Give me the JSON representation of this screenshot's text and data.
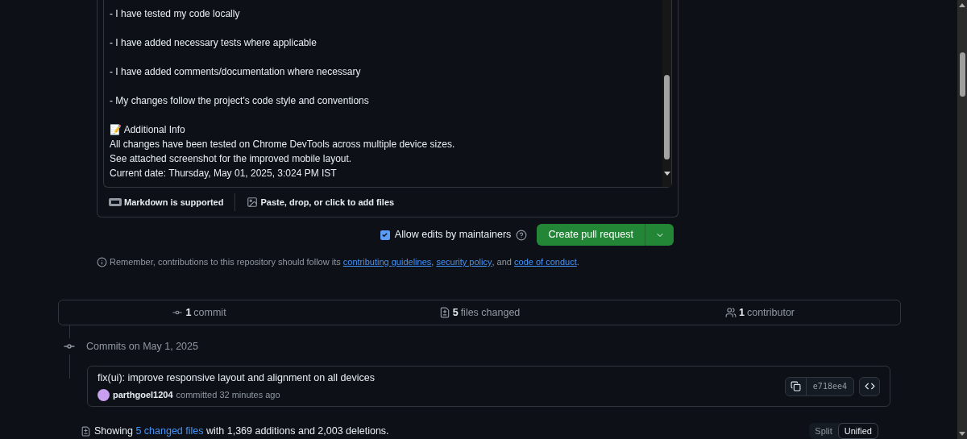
{
  "description": {
    "paragraphs": [
      [
        "-  I have tested my code locally"
      ],
      [
        "- I have added necessary tests where applicable"
      ],
      [
        "- I have added comments/documentation where necessary"
      ],
      [
        "- My changes follow the project's code style and conventions"
      ],
      [
        "📝 Additional Info",
        "All changes have been tested on Chrome DevTools across multiple device sizes.",
        "See attached screenshot for the improved mobile layout.",
        "Current date: Thursday, May 01, 2025, 3:024 PM IST"
      ]
    ],
    "footer": [
      "Markdown is supported",
      "Paste, drop, or click to add files"
    ]
  },
  "allow_edits": {
    "label": "Allow edits by maintainers",
    "checked": true
  },
  "create_button": "Create pull request",
  "notice": {
    "text": "Remember, contributions to this repository should follow its",
    "links": [
      "contributing guidelines",
      "security policy",
      "code of conduct"
    ],
    "joiners": [
      ",",
      ", and",
      "."
    ]
  },
  "summary": [
    {
      "kind": "commit",
      "count": "1",
      "label": "commit"
    },
    {
      "kind": "files",
      "count": "5",
      "label": "files changed"
    },
    {
      "kind": "contributor",
      "count": "1",
      "label": "contributor"
    }
  ],
  "commits_heading": "Commits on May 1, 2025",
  "commit": {
    "message": "fix(ui): improve responsive layout and alignment on all devices",
    "author": "parthgoel1204",
    "meta": "committed 32 minutes ago",
    "sha": "e718ee4"
  },
  "showing": {
    "prefix": "Showing",
    "link": "5 changed files",
    "suffix": "with 1,369 additions and 2,003 deletions."
  },
  "view_tabs": [
    {
      "label": "Split",
      "selected": false
    },
    {
      "label": "Unified",
      "selected": true
    }
  ]
}
